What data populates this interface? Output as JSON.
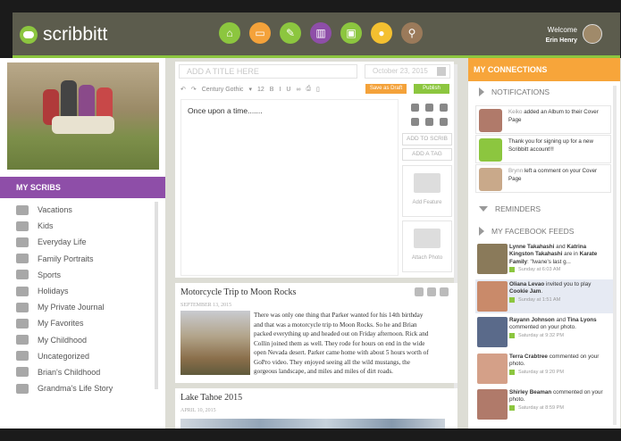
{
  "header": {
    "logo_text": "scribbitt",
    "welcome_label": "Welcome",
    "user_name": "Erin Henry",
    "nav_icons": [
      {
        "name": "home-icon",
        "color": "#8cc63f",
        "glyph": "⌂"
      },
      {
        "name": "presentation-icon",
        "color": "#f4a23a",
        "glyph": "▭"
      },
      {
        "name": "write-icon",
        "color": "#8cc63f",
        "glyph": "✎"
      },
      {
        "name": "scribs-icon",
        "color": "#8e4ea8",
        "glyph": "▥"
      },
      {
        "name": "photos-icon",
        "color": "#8cc63f",
        "glyph": "▣"
      },
      {
        "name": "profile-icon",
        "color": "#f4c030",
        "glyph": "●"
      },
      {
        "name": "search-icon",
        "color": "#9b7a5a",
        "glyph": "⚲"
      }
    ]
  },
  "sidebar": {
    "heading": "MY SCRIBS",
    "items": [
      {
        "label": "Vacations",
        "icon": "suitcase-icon"
      },
      {
        "label": "Kids",
        "icon": "kids-icon"
      },
      {
        "label": "Everyday Life",
        "icon": "sun-icon"
      },
      {
        "label": "Family Portraits",
        "icon": "portrait-icon"
      },
      {
        "label": "Sports",
        "icon": "ball-icon"
      },
      {
        "label": "Holidays",
        "icon": "tree-icon"
      },
      {
        "label": "My Private Journal",
        "icon": "lock-icon"
      },
      {
        "label": "My Favorites",
        "icon": "heart-icon"
      },
      {
        "label": "My Childhood",
        "icon": "flower-icon"
      },
      {
        "label": "Uncategorized",
        "icon": "question-icon"
      },
      {
        "label": "Brian's Childhood",
        "icon": "smiley-icon"
      },
      {
        "label": "Grandma's Life Story",
        "icon": "book-icon"
      }
    ]
  },
  "editor": {
    "title_placeholder": "ADD A TITLE HERE",
    "date_placeholder": "October 23, 2015",
    "font_name": "Century Gothic",
    "font_size": "12",
    "save_draft": "Save as Draft",
    "publish": "Publish",
    "body_text": "Once upon a time.......",
    "add_to_scrib": "ADD TO SCRIB",
    "add_a_tag": "ADD A TAG",
    "add_feature": "Add Feature",
    "attach_photo": "Attach Photo"
  },
  "posts": [
    {
      "title": "Motorcycle Trip to Moon Rocks",
      "date": "SEPTEMBER 13, 2015",
      "body": "There was only one thing that Parker wanted for his 14th birthday and that was a motorcycle trip to Moon Rocks. So he and Brian packed everything up and headed out on Friday afternoon. Rick and Collin joined them as well. They rode for hours on end in the wide open Nevada desert. Parker came home with about 5 hours worth of GoPro video. They enjoyed seeing all the wild mustangs, the gorgeous landscape, and miles and miles of dirt roads."
    },
    {
      "title": "Lake Tahoe 2015",
      "date": "APRIL 10, 2015"
    }
  ],
  "connections": {
    "heading": "MY CONNECTIONS",
    "notifications_label": "NOTIFICATIONS",
    "reminders_label": "REMINDERS",
    "facebook_label": "MY FACEBOOK FEEDS",
    "notifications": [
      {
        "who": "Keiko",
        "text": "added an Album to their Cover Page"
      },
      {
        "who": "",
        "text": "Thank you for signing up for a new Scribbitt account!!!"
      },
      {
        "who": "Brynn",
        "text": "left a comment on your Cover Page"
      }
    ],
    "feeds": [
      {
        "names": "Lynne Takahashi",
        "and": "and",
        "names2": "Katrina Kingston Takahashi",
        "text": "are in",
        "group": "Karate Family",
        "quote": ": \"Iwane's last g...",
        "time": "Sunday at 6:03 AM"
      },
      {
        "names": "Oliana Levao",
        "and": "",
        "names2": "",
        "text": "invited you to play",
        "group": "Cookie Jam",
        "quote": ".",
        "time": "Sunday at 1:51 AM"
      },
      {
        "names": "Rayann Johnson",
        "and": "and",
        "names2": "Tina Lyons",
        "text": "commented on your photo.",
        "group": "",
        "quote": "",
        "time": "Saturday at 9:32 PM"
      },
      {
        "names": "Terra Crabtree",
        "and": "",
        "names2": "",
        "text": "commented on your photo.",
        "group": "",
        "quote": "",
        "time": "Saturday at 9:20 PM"
      },
      {
        "names": "Shirley Beaman",
        "and": "",
        "names2": "",
        "text": "commented on your photo.",
        "group": "",
        "quote": "",
        "time": "Saturday at 8:59 PM"
      }
    ]
  }
}
